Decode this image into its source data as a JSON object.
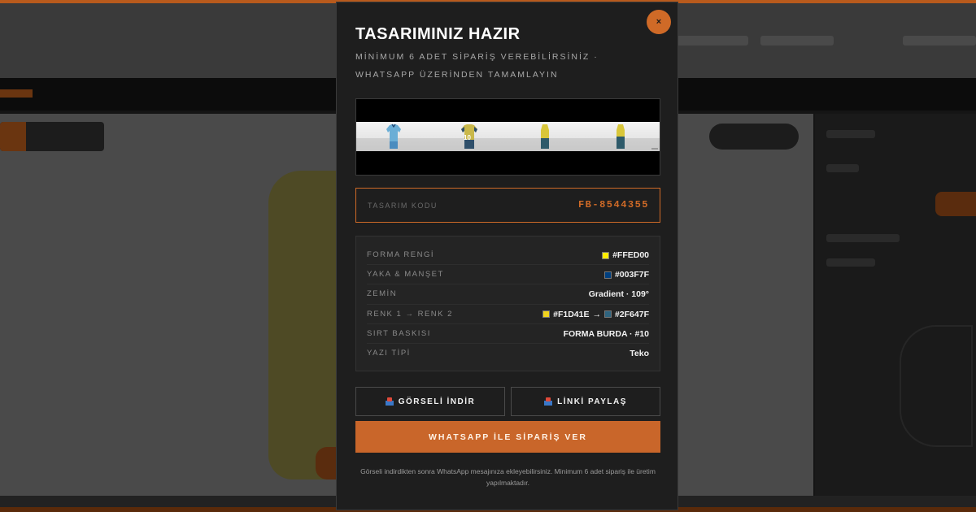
{
  "modal": {
    "close_label": "×",
    "title": "TASARIMINIZ HAZIR",
    "subtitle": "MİNİMUM 6 ADET SİPARİŞ VEREBİLİRSİNİZ · WHATSAPP ÜZERİNDEN TAMAMLAYIN",
    "preview": {
      "jersey_numbers": [
        "10"
      ]
    },
    "design_code": {
      "label": "TASARIM KODU",
      "value": "FB-8544355"
    },
    "details": [
      {
        "label": "FORMA RENGİ",
        "value": "#FFED00",
        "swatch": "#FFED00"
      },
      {
        "label": "YAKA & MANŞET",
        "value": "#003F7F",
        "swatch": "#003F7F"
      },
      {
        "label": "ZEMİN",
        "value": "Gradient · 109°"
      },
      {
        "label": "RENK 1 → RENK 2",
        "value_a": "#F1D41E",
        "arrow": "→",
        "value_b": "#2F647F",
        "swatch_a": "#F1D41E",
        "swatch_b": "#2F647F"
      },
      {
        "label": "SIRT BASKISI",
        "value": "FORMA BURDA · #10"
      },
      {
        "label": "YAZI TİPİ",
        "value": "Teko"
      }
    ],
    "buttons": {
      "download": "GÖRSELİ İNDİR",
      "share": "LİNKİ PAYLAŞ",
      "whatsapp": "WHATSAPP İLE SİPARİŞ VER"
    },
    "footnote": "Görseli indirdikten sonra WhatsApp mesajınıza ekleyebilirsiniz. Minimum 6 adet sipariş ile üretim yapılmaktadır."
  },
  "colors": {
    "accent": "#CF6A27",
    "modal_bg": "#1E1E1E",
    "overlay_bg": "#151515"
  },
  "icons": [
    "close-icon",
    "download-icon",
    "share-icon"
  ]
}
